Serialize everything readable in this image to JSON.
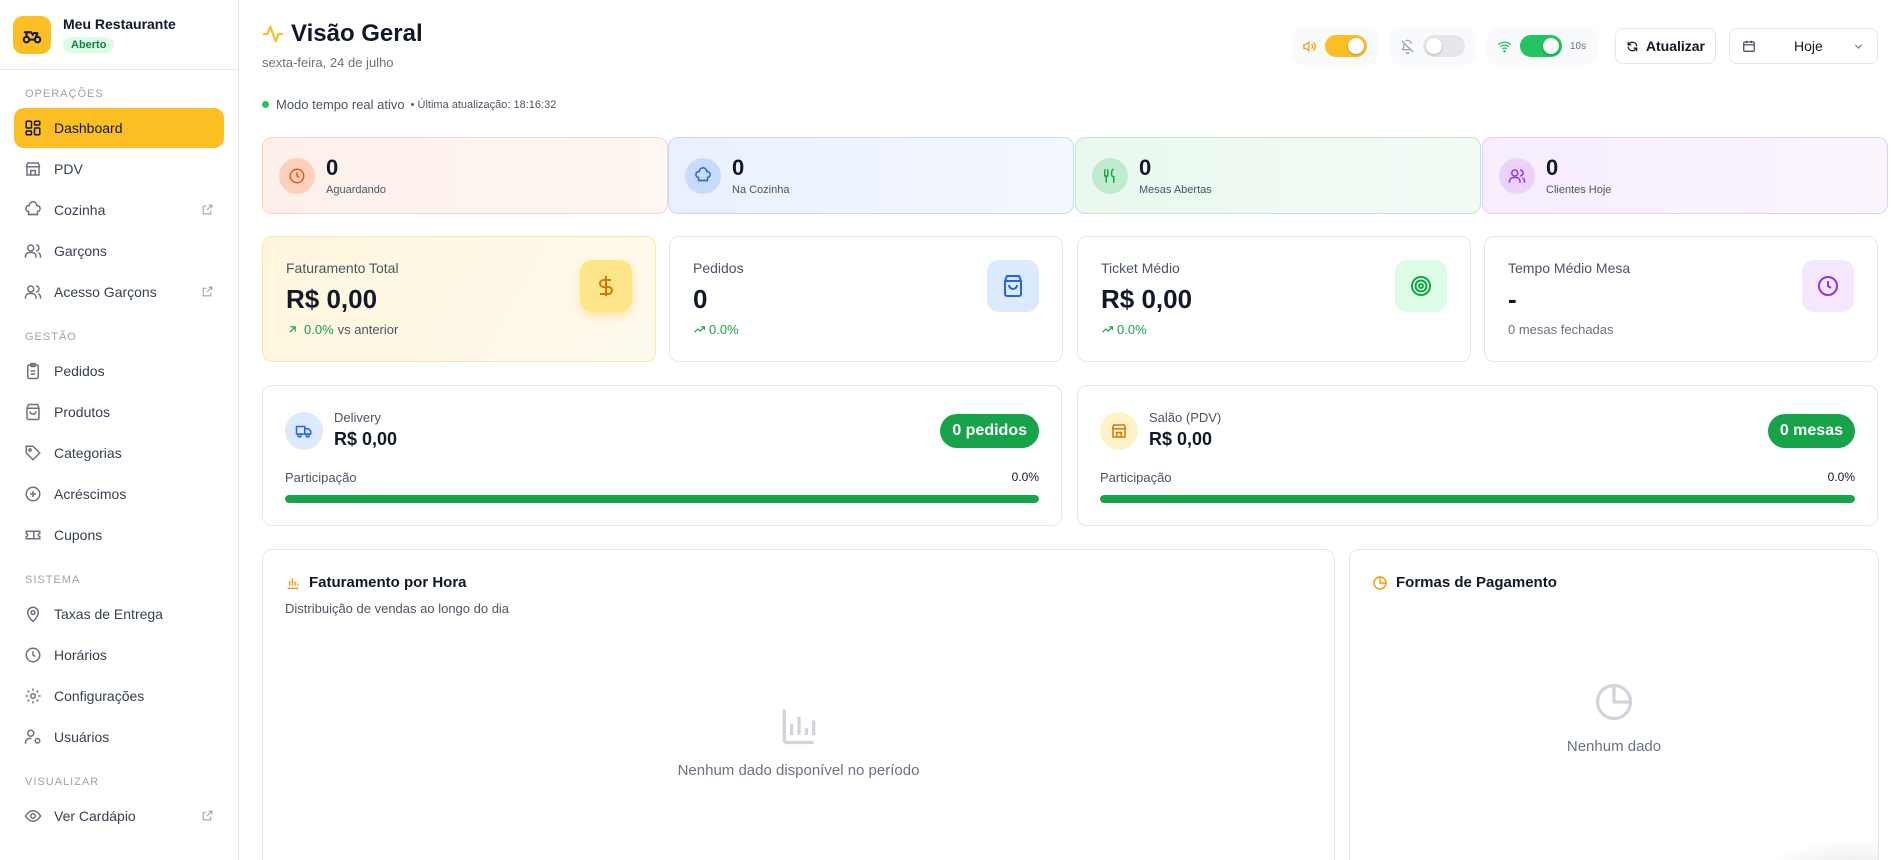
{
  "brand": {
    "name": "Meu Restaurante",
    "status": "Aberto"
  },
  "nav": {
    "sections": {
      "operacoes": "OPERAÇÕES",
      "gestao": "GESTÃO",
      "sistema": "SISTEMA",
      "visualizar": "VISUALIZAR"
    },
    "items": {
      "dashboard": "Dashboard",
      "pdv": "PDV",
      "cozinha": "Cozinha",
      "garcons": "Garçons",
      "acesso_garcons": "Acesso Garçons",
      "pedidos": "Pedidos",
      "produtos": "Produtos",
      "categorias": "Categorias",
      "acrescimos": "Acréscimos",
      "cupons": "Cupons",
      "taxas": "Taxas de Entrega",
      "horarios": "Horários",
      "configuracoes": "Configurações",
      "usuarios": "Usuários",
      "ver_cardapio": "Ver Cardápio"
    }
  },
  "header": {
    "title": "Visão Geral",
    "date": "sexta-feira, 24 de julho",
    "live_text": "Modo tempo real ativo",
    "last_update": "• Última atualização: 18:16:32",
    "sound_toggle": "on",
    "notification_toggle": "off",
    "realtime_toggle": "on",
    "interval": "10s",
    "refresh_label": "Atualizar",
    "period_value": "Hoje"
  },
  "status_cards": {
    "aguardando": {
      "value": "0",
      "label": "Aguardando"
    },
    "cozinha": {
      "value": "0",
      "label": "Na Cozinha"
    },
    "mesas": {
      "value": "0",
      "label": "Mesas Abertas"
    },
    "clientes": {
      "value": "0",
      "label": "Clientes Hoje"
    }
  },
  "kpis": {
    "faturamento": {
      "label": "Faturamento Total",
      "value": "R$ 0,00",
      "trend": "0.0%",
      "trend_suffix": "vs anterior"
    },
    "pedidos": {
      "label": "Pedidos",
      "value": "0",
      "trend": "0.0%"
    },
    "ticket": {
      "label": "Ticket Médio",
      "value": "R$ 0,00",
      "trend": "0.0%"
    },
    "tempo": {
      "label": "Tempo Médio Mesa",
      "value": "-",
      "sub": "0 mesas fechadas"
    }
  },
  "channels": {
    "delivery": {
      "name": "Delivery",
      "amount": "R$ 0,00",
      "badge": "0 pedidos",
      "participation_label": "Participação",
      "participation": "0.0%"
    },
    "salao": {
      "name": "Salão (PDV)",
      "amount": "R$ 0,00",
      "badge": "0 mesas",
      "participation_label": "Participação",
      "participation": "0.0%"
    }
  },
  "panels": {
    "hourly": {
      "title": "Faturamento por Hora",
      "subtitle": "Distribuição de vendas ao longo do dia",
      "empty": "Nenhum dado disponível no período"
    },
    "payments": {
      "title": "Formas de Pagamento",
      "empty": "Nenhum dado"
    }
  },
  "colors": {
    "accent": "#fbbf24",
    "success": "#16a34a",
    "live": "#22c55e"
  }
}
